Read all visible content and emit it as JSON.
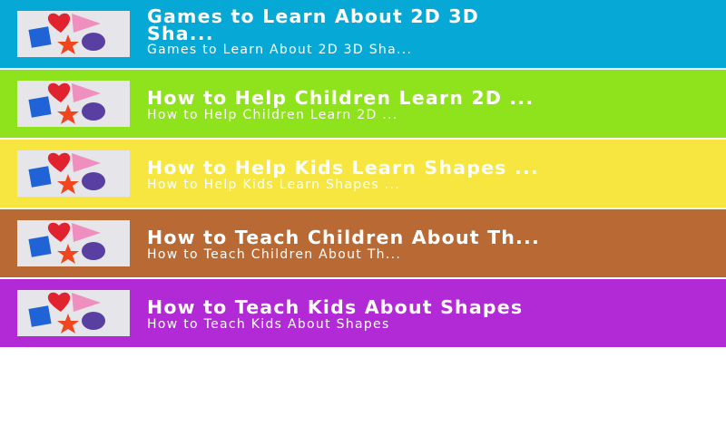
{
  "articles": [
    {
      "title": "Games to Learn About 2D 3D Sha...",
      "title_line1": "Games to Learn About 2D 3D",
      "title_line2": "Sha...",
      "subtitle": "Games to Learn About 2D 3D Sha...",
      "color": "#06a8d6",
      "icon": "shapes-thumbnail-icon"
    },
    {
      "title": "How to Help Children Learn 2D ...",
      "subtitle": "How to Help Children Learn 2D ...",
      "color": "#8fe31d",
      "icon": "shapes-thumbnail-icon"
    },
    {
      "title": "How to Help Kids Learn Shapes ...",
      "subtitle": "How to Help Kids Learn Shapes ...",
      "color": "#f7e640",
      "icon": "shapes-thumbnail-icon"
    },
    {
      "title": "How to Teach Children About Th...",
      "subtitle": "How to Teach Children About Th...",
      "color": "#b96933",
      "icon": "shapes-thumbnail-icon"
    },
    {
      "title": "How to Teach Kids About Shapes",
      "subtitle": "How to Teach Kids About Shapes",
      "color": "#b12ad6",
      "icon": "shapes-thumbnail-icon"
    }
  ]
}
